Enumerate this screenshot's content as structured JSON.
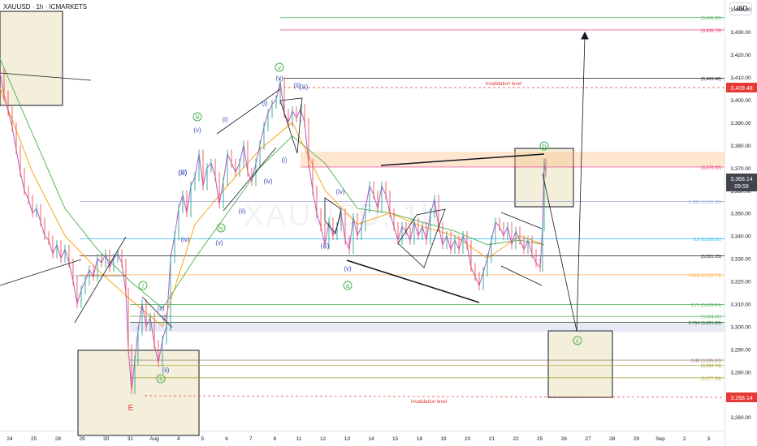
{
  "header": {
    "symbol": "XAUUSD · 1h · ICMARKETS",
    "currency": "USD",
    "watermark": "XAUUSD, 1h"
  },
  "chart_data": {
    "type": "line",
    "title": "XAUUSD · 1h · ICMARKETS",
    "price_axis": {
      "ticks": [
        "3,440.00",
        "3,430.00",
        "3,420.00",
        "3,410.00",
        "3,400.00",
        "3,390.00",
        "3,380.00",
        "3,370.00",
        "3,360.00",
        "3,350.00",
        "3,340.00",
        "3,330.00",
        "3,320.00",
        "3,310.00",
        "3,300.00",
        "3,290.00",
        "3,280.00",
        "3,270.00",
        "3,260.00"
      ],
      "ylim": [
        3254,
        3444
      ]
    },
    "time_axis": {
      "ticks": [
        "24",
        "25",
        "28",
        "29",
        "30",
        "31",
        "Aug",
        "4",
        "5",
        "6",
        "7",
        "8",
        "11",
        "12",
        "13",
        "14",
        "15",
        "18",
        "19",
        "20",
        "21",
        "22",
        "25",
        "26",
        "27",
        "28",
        "29",
        "Sep",
        "2",
        "3"
      ]
    },
    "price_labels": {
      "invalidation_top": "3,409.48",
      "current_price": "3,368.14",
      "countdown": "09:59",
      "invalidation_bottom": "3,268.14"
    },
    "levels": [
      {
        "price": 3436.22,
        "label": "(3,436.22)",
        "color": "#4caf50"
      },
      {
        "price": 3430.79,
        "label": "(3,430.79)",
        "color": "#e91e63"
      },
      {
        "price": 3409.48,
        "label": "(3,409.48)",
        "color": "#131722"
      },
      {
        "price": 3370.32,
        "label": "(3,370.32)",
        "color": "#e91e63"
      },
      {
        "price": 3355.05,
        "label": "0.382 (3,355.05)",
        "color": "#9fa8da"
      },
      {
        "price": 3338.61,
        "label": "0.5 (3,338.61)",
        "color": "#29b6f6"
      },
      {
        "price": 3331.15,
        "label": "(3,331.15)",
        "color": "#131722"
      },
      {
        "price": 3322.73,
        "label": "0.618 (3,322.73)",
        "color": "#ffa726"
      },
      {
        "price": 3309.64,
        "label": "0.71 (3,309.64)",
        "color": "#4caf50"
      },
      {
        "price": 3304.41,
        "label": "(3,304.41)",
        "color": "#4caf50"
      },
      {
        "price": 3301.8,
        "label": "0.764 (3,301.80)",
        "color": "#1b5e20"
      },
      {
        "price": 3285.1,
        "label": "0.88 (3,285.10)",
        "color": "#8d6e63"
      },
      {
        "price": 3282.74,
        "label": "(3,282.74)",
        "color": "#9e9d24"
      },
      {
        "price": 3277.29,
        "label": "(3,277.29)",
        "color": "#9e9d24"
      }
    ],
    "annotations": {
      "invalidation_top": "Invalidation level",
      "invalidation_bottom": "Invalidation level",
      "labels": [
        "v",
        "(v)",
        "iii",
        "(iii)",
        "(i)",
        "(v)",
        "(iii)",
        "iv",
        "(iv)",
        "(ii)",
        "(i)",
        "(ii)",
        "i",
        "(i)",
        "(ii)",
        "ii",
        "E",
        "(iii)",
        "(iv)",
        "(v)",
        "a",
        "b",
        "c",
        "(iv)",
        "(i)",
        "(ii)",
        "(iii)",
        "(v)"
      ]
    },
    "price_path": [
      [
        0,
        3412
      ],
      [
        5,
        3402
      ],
      [
        10,
        3395
      ],
      [
        15,
        3388
      ],
      [
        20,
        3378
      ],
      [
        25,
        3368
      ],
      [
        30,
        3360
      ],
      [
        35,
        3356
      ],
      [
        40,
        3350
      ],
      [
        45,
        3352
      ],
      [
        50,
        3346
      ],
      [
        55,
        3340
      ],
      [
        60,
        3338
      ],
      [
        65,
        3332
      ],
      [
        70,
        3336
      ],
      [
        75,
        3330
      ],
      [
        80,
        3334
      ],
      [
        85,
        3328
      ],
      [
        90,
        3320
      ],
      [
        95,
        3310
      ],
      [
        100,
        3316
      ],
      [
        105,
        3320
      ],
      [
        110,
        3325
      ],
      [
        115,
        3322
      ],
      [
        120,
        3330
      ],
      [
        125,
        3328
      ],
      [
        130,
        3332
      ],
      [
        135,
        3326
      ],
      [
        140,
        3330
      ],
      [
        145,
        3332
      ],
      [
        150,
        3328
      ],
      [
        155,
        3315
      ],
      [
        158,
        3290
      ],
      [
        162,
        3272
      ],
      [
        166,
        3285
      ],
      [
        170,
        3298
      ],
      [
        175,
        3310
      ],
      [
        180,
        3300
      ],
      [
        185,
        3304
      ],
      [
        190,
        3292
      ],
      [
        195,
        3284
      ],
      [
        200,
        3294
      ],
      [
        205,
        3300
      ],
      [
        210,
        3330
      ],
      [
        215,
        3340
      ],
      [
        220,
        3352
      ],
      [
        225,
        3358
      ],
      [
        230,
        3350
      ],
      [
        235,
        3362
      ],
      [
        240,
        3366
      ],
      [
        245,
        3376
      ],
      [
        250,
        3362
      ],
      [
        255,
        3370
      ],
      [
        260,
        3372
      ],
      [
        265,
        3366
      ],
      [
        270,
        3354
      ],
      [
        275,
        3364
      ],
      [
        280,
        3376
      ],
      [
        285,
        3372
      ],
      [
        290,
        3368
      ],
      [
        295,
        3372
      ],
      [
        300,
        3380
      ],
      [
        305,
        3368
      ],
      [
        310,
        3364
      ],
      [
        315,
        3372
      ],
      [
        320,
        3380
      ],
      [
        325,
        3388
      ],
      [
        330,
        3394
      ],
      [
        335,
        3398
      ],
      [
        340,
        3400
      ],
      [
        345,
        3408
      ],
      [
        350,
        3394
      ],
      [
        355,
        3390
      ],
      [
        360,
        3395
      ],
      [
        365,
        3392
      ],
      [
        370,
        3396
      ],
      [
        375,
        3390
      ],
      [
        380,
        3372
      ],
      [
        385,
        3360
      ],
      [
        390,
        3350
      ],
      [
        395,
        3344
      ],
      [
        400,
        3336
      ],
      [
        405,
        3346
      ],
      [
        410,
        3340
      ],
      [
        415,
        3344
      ],
      [
        420,
        3350
      ],
      [
        425,
        3338
      ],
      [
        430,
        3334
      ],
      [
        435,
        3348
      ],
      [
        440,
        3340
      ],
      [
        445,
        3344
      ],
      [
        450,
        3352
      ],
      [
        455,
        3362
      ],
      [
        460,
        3358
      ],
      [
        465,
        3352
      ],
      [
        470,
        3362
      ],
      [
        475,
        3358
      ],
      [
        480,
        3350
      ],
      [
        485,
        3344
      ],
      [
        490,
        3338
      ],
      [
        495,
        3344
      ],
      [
        500,
        3342
      ],
      [
        505,
        3338
      ],
      [
        510,
        3346
      ],
      [
        515,
        3340
      ],
      [
        520,
        3344
      ],
      [
        525,
        3338
      ],
      [
        530,
        3350
      ],
      [
        535,
        3356
      ],
      [
        540,
        3344
      ],
      [
        545,
        3336
      ],
      [
        550,
        3340
      ],
      [
        555,
        3334
      ],
      [
        560,
        3338
      ],
      [
        565,
        3334
      ],
      [
        570,
        3340
      ],
      [
        575,
        3336
      ],
      [
        580,
        3326
      ],
      [
        585,
        3322
      ],
      [
        590,
        3318
      ],
      [
        595,
        3324
      ],
      [
        600,
        3330
      ],
      [
        605,
        3338
      ],
      [
        610,
        3346
      ],
      [
        615,
        3344
      ],
      [
        620,
        3340
      ],
      [
        625,
        3344
      ],
      [
        630,
        3336
      ],
      [
        635,
        3342
      ],
      [
        640,
        3338
      ],
      [
        645,
        3334
      ],
      [
        650,
        3338
      ],
      [
        655,
        3332
      ],
      [
        660,
        3328
      ],
      [
        665,
        3326
      ],
      [
        668,
        3344
      ],
      [
        670,
        3372
      ],
      [
        672,
        3368
      ]
    ],
    "ma_fast": [
      [
        0,
        3405
      ],
      [
        40,
        3368
      ],
      [
        80,
        3340
      ],
      [
        120,
        3325
      ],
      [
        160,
        3312
      ],
      [
        200,
        3300
      ],
      [
        240,
        3345
      ],
      [
        280,
        3362
      ],
      [
        320,
        3378
      ],
      [
        360,
        3390
      ],
      [
        400,
        3360
      ],
      [
        440,
        3345
      ],
      [
        480,
        3350
      ],
      [
        520,
        3344
      ],
      [
        560,
        3340
      ],
      [
        600,
        3330
      ],
      [
        640,
        3340
      ],
      [
        670,
        3336
      ]
    ],
    "ma_slow": [
      [
        0,
        3418
      ],
      [
        40,
        3385
      ],
      [
        80,
        3352
      ],
      [
        120,
        3334
      ],
      [
        160,
        3320
      ],
      [
        200,
        3308
      ],
      [
        240,
        3330
      ],
      [
        280,
        3350
      ],
      [
        320,
        3370
      ],
      [
        360,
        3384
      ],
      [
        400,
        3372
      ],
      [
        440,
        3352
      ],
      [
        480,
        3350
      ],
      [
        520,
        3346
      ],
      [
        560,
        3342
      ],
      [
        600,
        3336
      ],
      [
        640,
        3338
      ],
      [
        670,
        3336
      ]
    ]
  }
}
